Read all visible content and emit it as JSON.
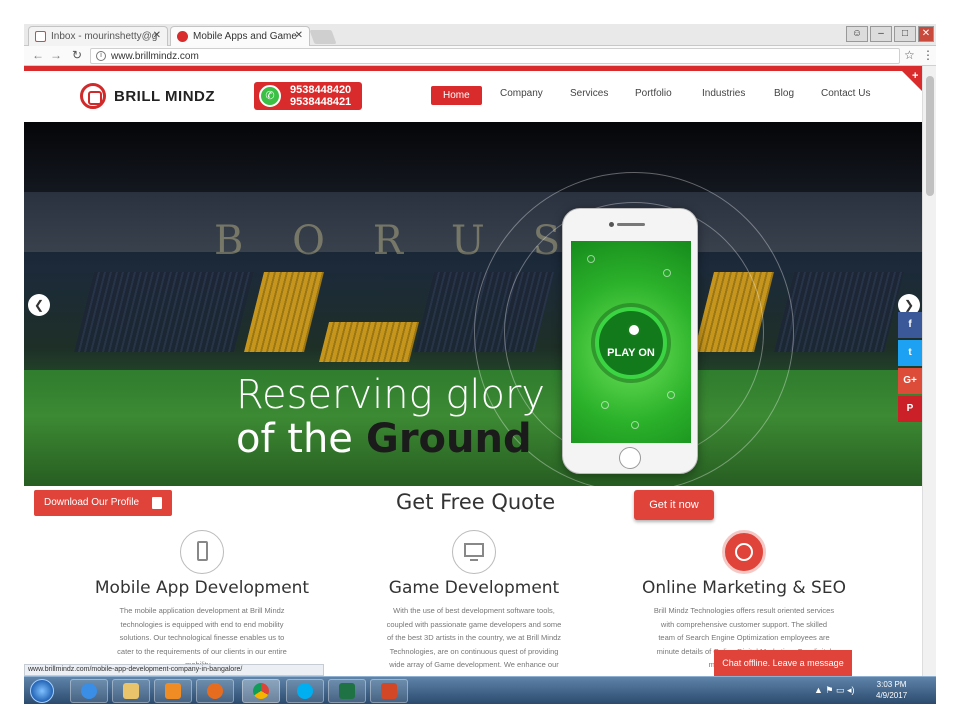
{
  "browser": {
    "tabs": [
      {
        "title": "Inbox - mourinshetty@g",
        "active": false
      },
      {
        "title": "Mobile Apps and Game",
        "active": true
      }
    ],
    "url": "www.brillmindz.com",
    "status_url": "www.brillmindz.com/mobile-app-development-company-in-bangalore/"
  },
  "site": {
    "brand": "BRILL MINDZ",
    "phones": [
      "9538448420",
      "9538448421"
    ],
    "nav": [
      "Home",
      "Company",
      "Services",
      "Portfolio",
      "Industries",
      "Blog",
      "Contact Us"
    ],
    "stadium_text": "BORUSS",
    "hero": {
      "line1": "Reserving glory",
      "line2_plain": "of the",
      "line2_bold": "Ground",
      "phone_button": "PLAY ON"
    },
    "social": [
      {
        "label": "f",
        "color": "#3b5998"
      },
      {
        "label": "t",
        "color": "#1da1f2"
      },
      {
        "label": "G+",
        "color": "#dd4b39"
      },
      {
        "label": "P",
        "color": "#cb2027"
      }
    ],
    "quote": {
      "download_label": "Download Our Profile",
      "title": "Get Free Quote",
      "cta": "Get it now"
    },
    "services": [
      {
        "title": "Mobile App Development",
        "text": [
          "The mobile application development at Brill Mindz",
          "technologies is equipped with end to end mobility",
          "solutions. Our technological finesse enables us to",
          "cater to the requirements of our clients in our entire",
          "mobility ..."
        ]
      },
      {
        "title": "Game Development",
        "text": [
          "With the use of best development software tools,",
          "coupled with passionate game developers and some",
          "of the best 3D artists in the country, we at Brill Mindz",
          "Technologies, are on continuous quest of providing",
          "wide array of Game development. We enhance our"
        ]
      },
      {
        "title": "Online Marketing & SEO",
        "text": [
          "Brill Mindz Technologies offers result oriented services",
          "with comprehensive customer support. The skilled",
          "team of Search Engine Optimization employees are",
          "minute details of Online Digital Marketing. Our digital",
          "marketing includes ..."
        ]
      }
    ],
    "chat_label": "Chat offline. Leave a message"
  },
  "taskbar": {
    "time": "3:03 PM",
    "date": "4/9/2017"
  },
  "colors": {
    "brand_red": "#d92b2b",
    "button_red": "#e0433a"
  }
}
